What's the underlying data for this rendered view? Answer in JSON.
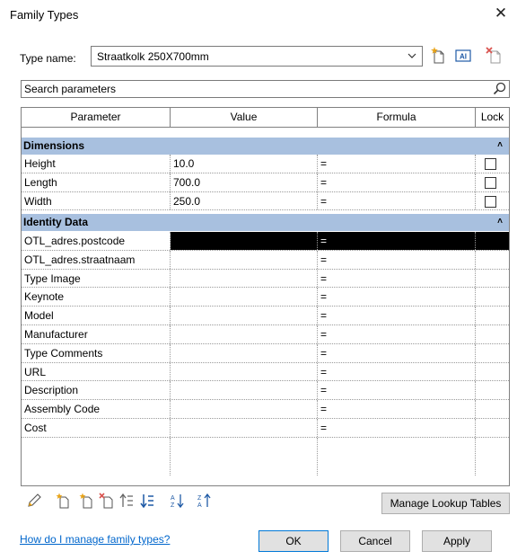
{
  "window": {
    "title": "Family Types",
    "close_label": "✕"
  },
  "type_name": {
    "label": "Type name:",
    "value": "Straatkolk 250X700mm"
  },
  "search": {
    "placeholder": "Search parameters"
  },
  "table": {
    "columns": [
      "Parameter",
      "Value",
      "Formula",
      "Lock"
    ],
    "groups": [
      {
        "name": "Dimensions",
        "rows": [
          {
            "parameter": "Height",
            "value": "10.0",
            "formula": "=",
            "lock": false
          },
          {
            "parameter": "Length",
            "value": "700.0",
            "formula": "=",
            "lock": false
          },
          {
            "parameter": "Width",
            "value": "250.0",
            "formula": "=",
            "lock": false
          }
        ]
      },
      {
        "name": "Identity Data",
        "rows": [
          {
            "parameter": "OTL_adres.postcode",
            "value": "",
            "formula": "=",
            "selected": true
          },
          {
            "parameter": "OTL_adres.straatnaam",
            "value": "",
            "formula": "="
          },
          {
            "parameter": "Type Image",
            "value": "",
            "formula": "="
          },
          {
            "parameter": "Keynote",
            "value": "",
            "formula": "="
          },
          {
            "parameter": "Model",
            "value": "",
            "formula": "="
          },
          {
            "parameter": "Manufacturer",
            "value": "",
            "formula": "="
          },
          {
            "parameter": "Type Comments",
            "value": "",
            "formula": "="
          },
          {
            "parameter": "URL",
            "value": "",
            "formula": "="
          },
          {
            "parameter": "Description",
            "value": "",
            "formula": "="
          },
          {
            "parameter": "Assembly Code",
            "value": "",
            "formula": "="
          },
          {
            "parameter": "Cost",
            "value": "",
            "formula": "="
          }
        ]
      }
    ]
  },
  "buttons": {
    "manage_lookup": "Manage Lookup Tables",
    "ok": "OK",
    "cancel": "Cancel",
    "apply": "Apply"
  },
  "help_link": "How do I manage family types?",
  "icons": {
    "top": [
      "new-type-icon",
      "rename-type-icon",
      "delete-type-icon"
    ],
    "bottom": [
      "edit-parameter-icon",
      "new-parameter-icon",
      "delete-parameter-icon",
      "move-up-icon",
      "move-down-icon",
      "sort-ascending-icon",
      "sort-descending-icon"
    ]
  },
  "colors": {
    "group_header": "#a8c0df",
    "selection": "#000000",
    "link": "#0066cc",
    "accent": "#0078d7"
  }
}
